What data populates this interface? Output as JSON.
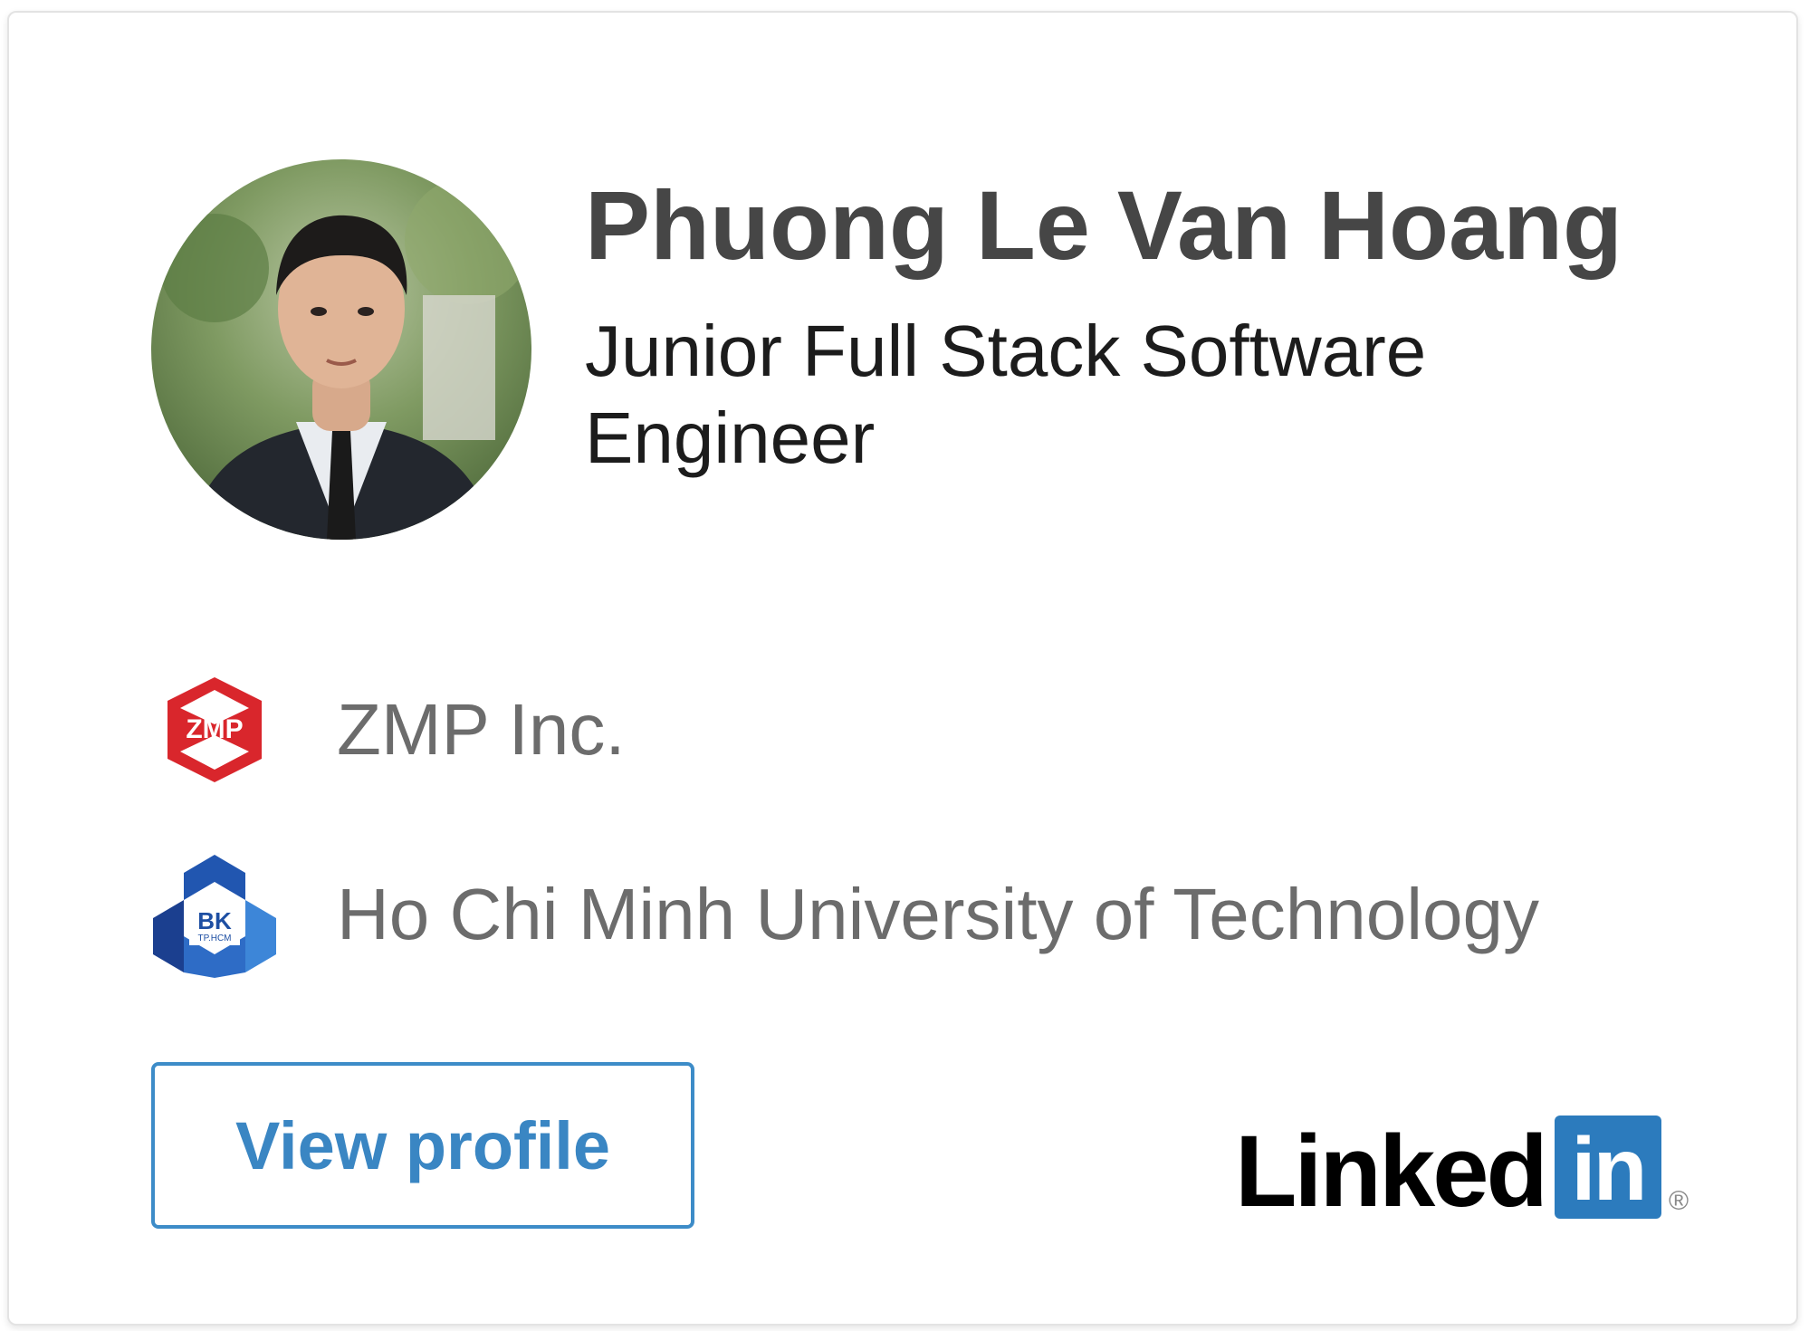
{
  "profile": {
    "name": "Phuong Le Van Hoang",
    "headline": "Junior Full Stack Software Engineer",
    "avatar_icon": "profile-photo"
  },
  "positions": [
    {
      "label": "ZMP Inc.",
      "logo_text": "ZMP",
      "logo_icon": "zmp-logo",
      "accent": "#d9262c"
    },
    {
      "label": "Ho Chi Minh University of Technology",
      "logo_text": "BK",
      "logo_subtext": "TP.HCM",
      "logo_icon": "bk-logo",
      "accent": "#1e4fa3"
    }
  ],
  "actions": {
    "view_profile_label": "View profile"
  },
  "brand": {
    "linked": "Linked",
    "in": "in",
    "registered": "®",
    "color": "#2c7bbd"
  },
  "colors": {
    "name": "#464646",
    "headline": "#1c1c1c",
    "secondary_text": "#6c6c6c",
    "button_border": "#3d8cc8"
  }
}
